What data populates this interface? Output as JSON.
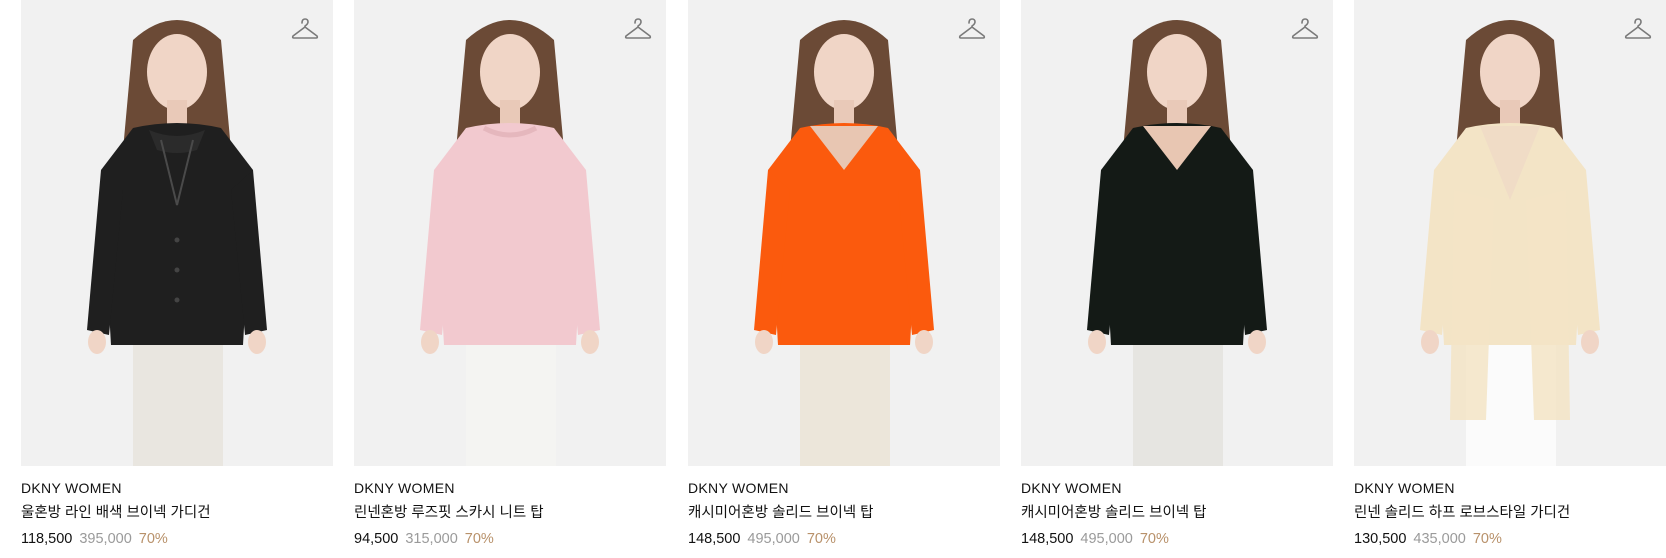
{
  "colors": {
    "discount": "#b8916a",
    "original_price": "#9a9a9a",
    "photo_bg": "#f1f1f1"
  },
  "products": [
    {
      "brand": "DKNY WOMEN",
      "name": "울혼방 라인 배색 브이넥 가디건",
      "price": "118,500",
      "original_price": "395,000",
      "discount": "70%",
      "wishlist_icon": "hanger-icon",
      "garment_color": "#1f1f1f",
      "bottom_color": "#e9e6e0",
      "style": "cardigan"
    },
    {
      "brand": "DKNY WOMEN",
      "name": "린넨혼방 루즈핏 스카시 니트 탑",
      "price": "94,500",
      "original_price": "315,000",
      "discount": "70%",
      "wishlist_icon": "hanger-icon",
      "garment_color": "#f2c9cf",
      "bottom_color": "#f4f4f2",
      "style": "crew"
    },
    {
      "brand": "DKNY WOMEN",
      "name": "캐시미어혼방 솔리드 브이넥 탑",
      "price": "148,500",
      "original_price": "495,000",
      "discount": "70%",
      "wishlist_icon": "hanger-icon",
      "garment_color": "#fb5a0d",
      "bottom_color": "#ece6da",
      "style": "vneck"
    },
    {
      "brand": "DKNY WOMEN",
      "name": "캐시미어혼방 솔리드 브이넥 탑",
      "price": "148,500",
      "original_price": "495,000",
      "discount": "70%",
      "wishlist_icon": "hanger-icon",
      "garment_color": "#141a16",
      "bottom_color": "#e6e5e1",
      "style": "vneck"
    },
    {
      "brand": "DKNY WOMEN",
      "name": "린넨 솔리드 하프 로브스타일 가디건",
      "price": "130,500",
      "original_price": "435,000",
      "discount": "70%",
      "wishlist_icon": "hanger-icon",
      "garment_color": "#f3e4c6",
      "bottom_color": "#fbfbfb",
      "style": "robe"
    }
  ]
}
